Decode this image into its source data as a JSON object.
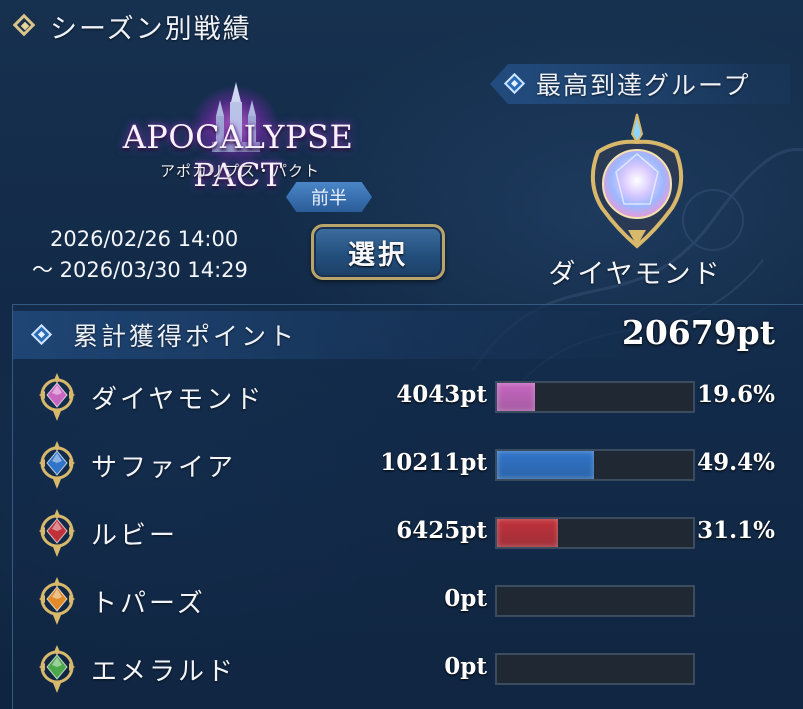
{
  "header": {
    "title": "シーズン別戦績"
  },
  "season": {
    "logo_title": "APOCALYPSE PACT",
    "logo_subtitle": "アポカリプス・パクト",
    "half_label": "前半",
    "start": "2026/02/26 14:00",
    "end": "～ 2026/03/30 14:29",
    "select_label": "選択"
  },
  "highest_group": {
    "header": "最高到達グループ",
    "name": "ダイヤモンド",
    "icon": "diamond-gem-emblem-icon"
  },
  "points": {
    "header": "累計獲得ポイント",
    "total": "20679pt",
    "rows": [
      {
        "name": "ダイヤモンド",
        "points": "4043pt",
        "percent": "19.6%",
        "fraction": 0.196,
        "color": "#c767c0",
        "icon": "diamond-gem-icon"
      },
      {
        "name": "サファイア",
        "points": "10211pt",
        "percent": "49.4%",
        "fraction": 0.494,
        "color": "#2f74c8",
        "icon": "sapphire-gem-icon"
      },
      {
        "name": "ルビー",
        "points": "6425pt",
        "percent": "31.1%",
        "fraction": 0.311,
        "color": "#c0313a",
        "icon": "ruby-gem-icon"
      },
      {
        "name": "トパーズ",
        "points": "0pt",
        "percent": "",
        "fraction": 0,
        "color": "#e08a2a",
        "icon": "topaz-gem-icon"
      },
      {
        "name": "エメラルド",
        "points": "0pt",
        "percent": "",
        "fraction": 0,
        "color": "#4aa84a",
        "icon": "emerald-gem-icon"
      }
    ]
  }
}
